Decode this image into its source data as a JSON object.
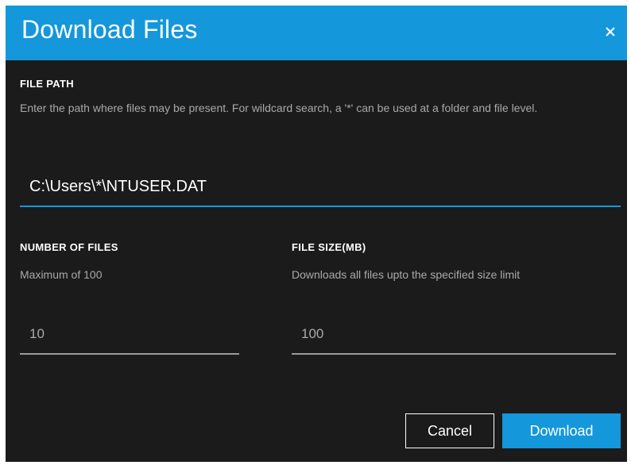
{
  "dialog": {
    "title": "Download Files",
    "close_icon": "close-icon"
  },
  "file_path": {
    "label": "FILE PATH",
    "help": "Enter the path where files may be present. For wildcard search, a '*' can be used at a folder and file level.",
    "value": "C:\\Users\\*\\NTUSER.DAT"
  },
  "number_of_files": {
    "label": "NUMBER OF FILES",
    "help": "Maximum of 100",
    "value": "10"
  },
  "file_size": {
    "label": "FILE SIZE(MB)",
    "help": "Downloads all files upto the specified size limit",
    "value": "100"
  },
  "actions": {
    "cancel_label": "Cancel",
    "download_label": "Download"
  },
  "colors": {
    "accent": "#1497db",
    "background": "#1b1b1b",
    "text_primary": "#ffffff",
    "text_secondary": "#a9a9a9"
  }
}
